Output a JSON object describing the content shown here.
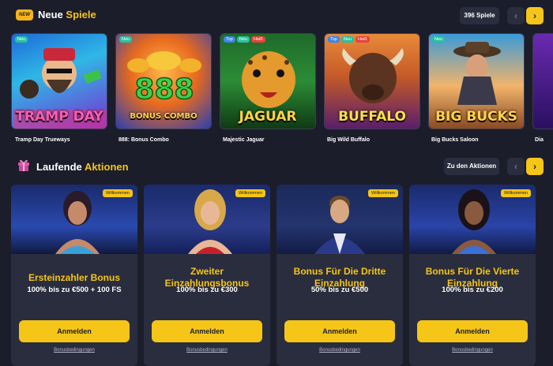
{
  "new_games": {
    "badge": "NEW",
    "title_a": "Neue",
    "title_b": "Spiele",
    "count": "396 Spiele",
    "prev": "‹",
    "next": "›",
    "games": [
      {
        "name": "Tramp Day Trueways",
        "logo": "TRAMP DAY",
        "tags": [
          "Neu"
        ]
      },
      {
        "name": "888: Bonus Combo",
        "logo": "BONUS COMBO",
        "tags": [
          "Neu"
        ]
      },
      {
        "name": "Majestic Jaguar",
        "logo": "JAGUAR",
        "tags": [
          "Top",
          "Neu",
          "Heiß"
        ]
      },
      {
        "name": "Big Wild Buffalo",
        "logo": "BUFFALO",
        "tags": [
          "Top",
          "Neu",
          "Heiß"
        ]
      },
      {
        "name": "Big Bucks Saloon",
        "logo": "BIG BUCKS",
        "tags": [
          "Neu"
        ]
      },
      {
        "name": "Dia",
        "logo": "",
        "tags": []
      }
    ]
  },
  "promos": {
    "title_a": "Laufende",
    "title_b": "Aktionen",
    "all_link": "Zu den Aktionen",
    "prev": "‹",
    "next": "›",
    "cards": [
      {
        "badge": "Willkommen",
        "title": "Ersteinzahler Bonus",
        "offer": "100% bis zu €500 + 100 FS",
        "button": "Anmelden",
        "terms": "Bonusbedingungen"
      },
      {
        "badge": "Willkommen",
        "title": "Zweiter Einzahlungsbonus",
        "offer": "100% bis zu €300",
        "button": "Anmelden",
        "terms": "Bonusbedingungen"
      },
      {
        "badge": "Willkommen",
        "title": "Bonus Für Die Dritte Einzahlung",
        "offer": "50% bis zu €500",
        "button": "Anmelden",
        "terms": "Bonusbedingungen"
      },
      {
        "badge": "Willkommen",
        "title": "Bonus Für Die Vierte Einzahlung",
        "offer": "100% bis zu €200",
        "button": "Anmelden",
        "terms": "Bonusbedingungen"
      }
    ]
  },
  "colors": {
    "accent": "#f5c518",
    "bg": "#1b1d2b",
    "panel": "#2a2d3d"
  }
}
